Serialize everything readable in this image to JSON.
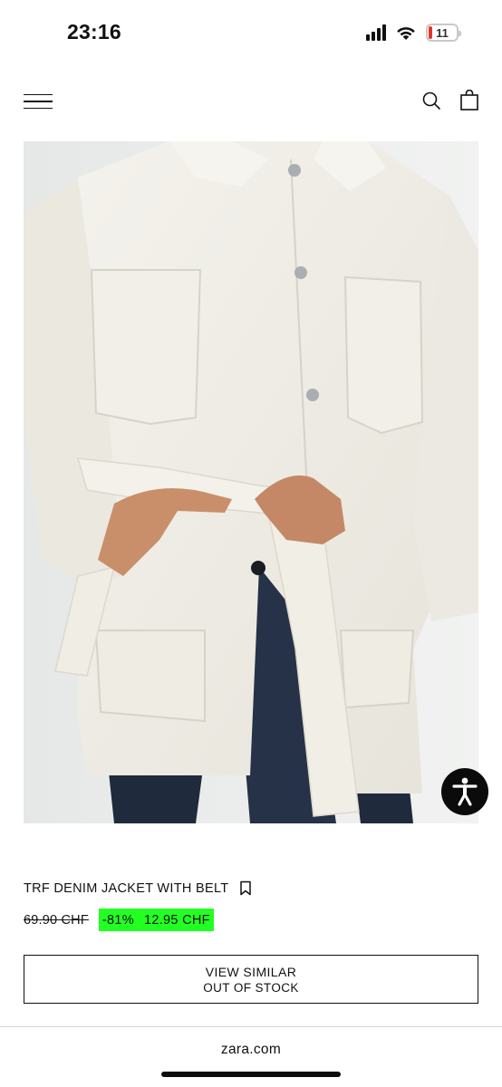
{
  "status_bar": {
    "time": "23:16",
    "battery_level": "11",
    "battery_fraction": 0.11,
    "battery_color": "#e5352b",
    "icons": [
      "signal-icon",
      "wifi-icon",
      "battery-icon"
    ]
  },
  "header": {
    "icons": [
      "menu-icon",
      "search-icon",
      "shopping-bag-icon"
    ]
  },
  "product": {
    "name": "TRF DENIM JACKET WITH BELT",
    "old_price": "69.90 CHF",
    "discount": "-81%",
    "new_price": "12.95 CHF",
    "sale_badge_color": "#22ff22",
    "bookmark_icon": "bookmark-icon"
  },
  "view_similar": {
    "line1": "VIEW SIMILAR",
    "line2": "OUT OF STOCK"
  },
  "accessibility_icon": "accessibility-icon",
  "browser": {
    "url": "zara.com"
  }
}
